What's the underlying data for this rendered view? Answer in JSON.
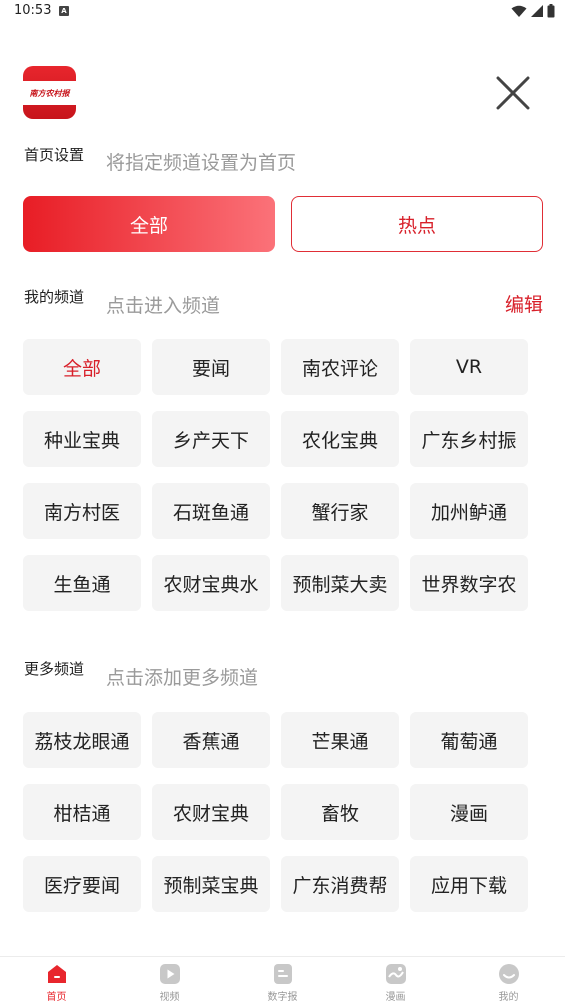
{
  "status_bar": {
    "time": "10:53",
    "notification_badge": "A"
  },
  "logo": {
    "text": "南方农村报"
  },
  "homepage_settings": {
    "title": "首页设置",
    "hint": "将指定频道设置为首页",
    "options": [
      {
        "label": "全部",
        "active": true
      },
      {
        "label": "热点",
        "active": false
      }
    ]
  },
  "my_channels": {
    "title": "我的频道",
    "hint": "点击进入频道",
    "edit_label": "编辑",
    "items": [
      {
        "label": "全部",
        "selected": true
      },
      {
        "label": "要闻"
      },
      {
        "label": "南农评论"
      },
      {
        "label": "VR"
      },
      {
        "label": "种业宝典"
      },
      {
        "label": "乡产天下"
      },
      {
        "label": "农化宝典"
      },
      {
        "label": "广东乡村振"
      },
      {
        "label": "南方村医"
      },
      {
        "label": "石斑鱼通"
      },
      {
        "label": "蟹行家"
      },
      {
        "label": "加州鲈通"
      },
      {
        "label": "生鱼通"
      },
      {
        "label": "农财宝典水"
      },
      {
        "label": "预制菜大卖"
      },
      {
        "label": "世界数字农"
      }
    ]
  },
  "more_channels": {
    "title": "更多频道",
    "hint": "点击添加更多频道",
    "items": [
      {
        "label": "荔枝龙眼通"
      },
      {
        "label": "香蕉通"
      },
      {
        "label": "芒果通"
      },
      {
        "label": "葡萄通"
      },
      {
        "label": "柑桔通"
      },
      {
        "label": "农财宝典"
      },
      {
        "label": "畜牧"
      },
      {
        "label": "漫画"
      },
      {
        "label": "医疗要闻"
      },
      {
        "label": "预制菜宝典"
      },
      {
        "label": "广东消费帮"
      },
      {
        "label": "应用下载"
      }
    ]
  },
  "tab_bar": {
    "tabs": [
      {
        "label": "首页",
        "icon": "home-icon",
        "active": true
      },
      {
        "label": "视频",
        "icon": "video-icon"
      },
      {
        "label": "数字报",
        "icon": "newspaper-icon"
      },
      {
        "label": "漫画",
        "icon": "comic-icon"
      },
      {
        "label": "我的",
        "icon": "profile-icon"
      }
    ]
  },
  "colors": {
    "accent": "#d8202a",
    "chip_bg": "#f4f4f4",
    "hint": "#9a9a9a"
  }
}
